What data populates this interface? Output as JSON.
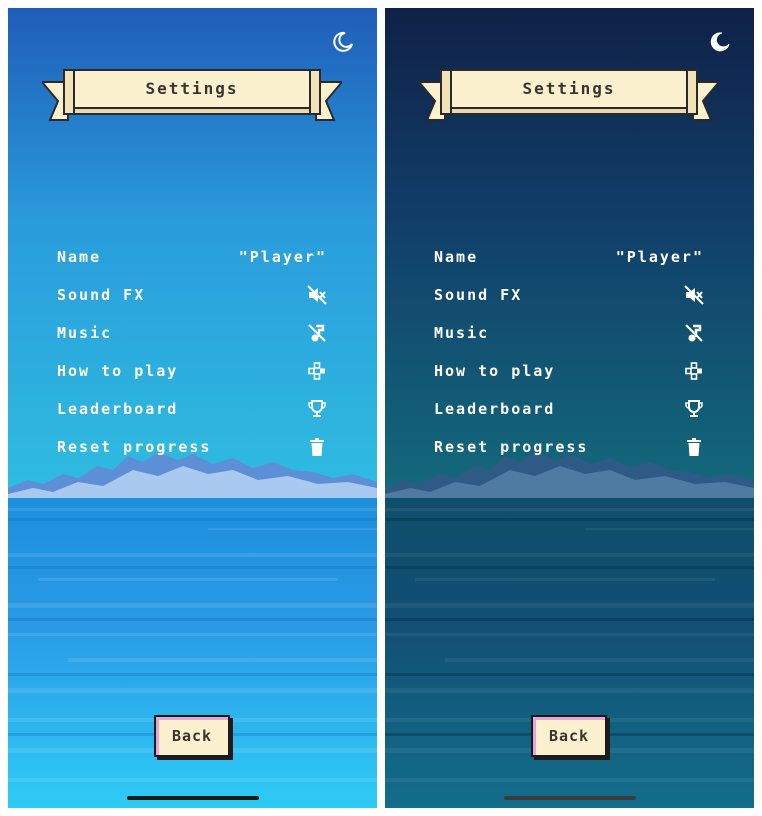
{
  "light": {
    "title": "Settings",
    "name_label": "Name",
    "name_value": "\"Player\"",
    "sound_label": "Sound FX",
    "music_label": "Music",
    "howto_label": "How to play",
    "leaderboard_label": "Leaderboard",
    "reset_label": "Reset progress",
    "back_label": "Back",
    "icons": [
      "moon-icon",
      "sound-off-icon",
      "music-off-icon",
      "gamepad-icon",
      "trophy-icon",
      "trash-icon"
    ]
  },
  "dark": {
    "title": "Settings",
    "name_label": "Name",
    "name_value": "\"Player\"",
    "sound_label": "Sound FX",
    "music_label": "Music",
    "howto_label": "How to play",
    "leaderboard_label": "Leaderboard",
    "reset_label": "Reset progress",
    "back_label": "Back",
    "icons": [
      "moon-icon",
      "sound-off-icon",
      "music-off-icon",
      "gamepad-icon",
      "trophy-icon",
      "trash-icon"
    ]
  },
  "colors": {
    "light_sky_top": "#1f5db8",
    "light_sky_bottom": "#2fbde0",
    "light_sea_top": "#1c8fdc",
    "light_sea_bottom": "#2ecbf5",
    "dark_sky_top": "#0f2147",
    "dark_sky_bottom": "#136a7c",
    "dark_sea_top": "#0f4f6c",
    "dark_sea_bottom": "#136d8b",
    "banner": "#fbf1cf",
    "button_shadow": "#e7a5d6"
  }
}
